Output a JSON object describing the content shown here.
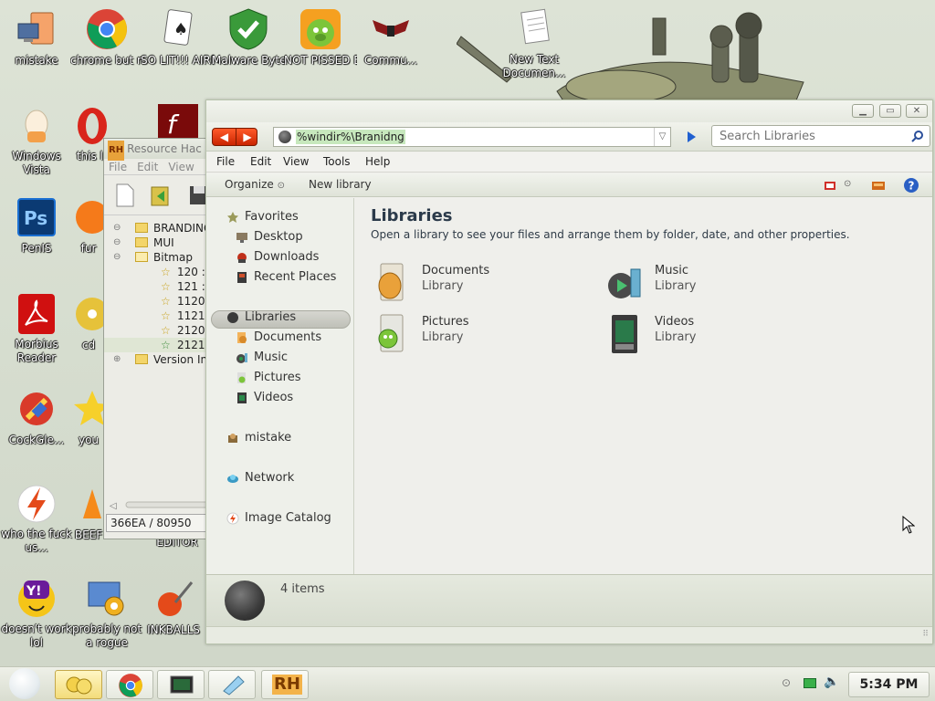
{
  "desktop": {
    "icons": [
      {
        "label": "mistake"
      },
      {
        "label": "chrome but normal c..."
      },
      {
        "label": "SO LIT!!! AIRE"
      },
      {
        "label": "Malware Bytes"
      },
      {
        "label": "NOT PISSED B..."
      },
      {
        "label": "Commu..."
      },
      {
        "label": "New Text Documen..."
      },
      {
        "label": "Windows Vista"
      },
      {
        "label": "this like"
      },
      {
        "label": "PenIS"
      },
      {
        "label": "fur"
      },
      {
        "label": "Morbius Reader"
      },
      {
        "label": "cd"
      },
      {
        "label": "CockGle..."
      },
      {
        "label": "you"
      },
      {
        "label": "who the fuck us..."
      },
      {
        "label": "BEEF"
      },
      {
        "label": "EDITOR"
      },
      {
        "label": "doesn't work lol"
      },
      {
        "label": "probably not a rogue"
      },
      {
        "label": "INKBALLS"
      }
    ]
  },
  "resource_hacker": {
    "title": "Resource Hac",
    "menu": [
      "File",
      "Edit",
      "View"
    ],
    "tree": [
      {
        "label": "BRANDING"
      },
      {
        "label": "MUI"
      },
      {
        "label": "Bitmap"
      },
      {
        "label": "120 :"
      },
      {
        "label": "121 :"
      },
      {
        "label": "1120"
      },
      {
        "label": "1121"
      },
      {
        "label": "2120"
      },
      {
        "label": "2121"
      },
      {
        "label": "Version In"
      }
    ],
    "status": "366EA / 80950"
  },
  "explorer": {
    "address": "%windir%\\Branidng",
    "search_placeholder": "Search Libraries",
    "menu": [
      "File",
      "Edit",
      "View",
      "Tools",
      "Help"
    ],
    "commands": {
      "organize": "Organize",
      "new_library": "New library"
    },
    "nav": {
      "favorites": "Favorites",
      "desktop": "Desktop",
      "downloads": "Downloads",
      "recent": "Recent Places",
      "libraries": "Libraries",
      "documents": "Documents",
      "music": "Music",
      "pictures": "Pictures",
      "videos": "Videos",
      "user": "mistake",
      "network": "Network",
      "image_catalog": "Image Catalog"
    },
    "content": {
      "title": "Libraries",
      "description": "Open a library to see your files and arrange them by folder, date, and other properties.",
      "libraries": [
        {
          "name": "Documents",
          "type": "Library"
        },
        {
          "name": "Music",
          "type": "Library"
        },
        {
          "name": "Pictures",
          "type": "Library"
        },
        {
          "name": "Videos",
          "type": "Library"
        }
      ]
    },
    "details": {
      "count": "4 items"
    }
  },
  "taskbar": {
    "clock": "5:34 PM"
  }
}
